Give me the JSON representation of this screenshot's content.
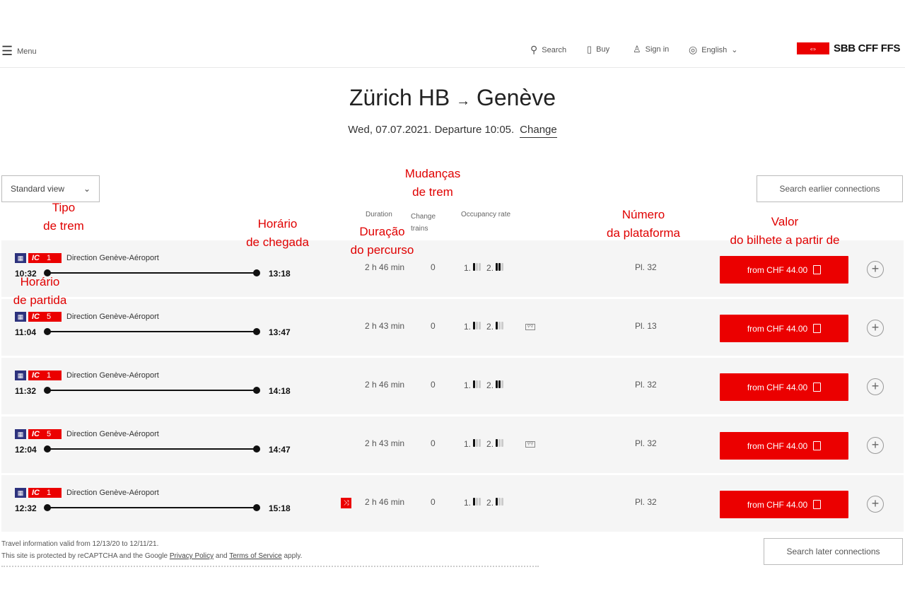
{
  "header": {
    "menu": "Menu",
    "search": "Search",
    "buy": "Buy",
    "sign_in": "Sign in",
    "language": "English",
    "logo": "SBB CFF FFS"
  },
  "journey": {
    "from": "Zürich HB",
    "arrow": "→",
    "to": "Genève",
    "date_line": "Wed, 07.07.2021. Departure 10:05.",
    "change": "Change"
  },
  "controls": {
    "view": "Standard view",
    "earlier": "Search earlier connections",
    "later": "Search later connections"
  },
  "columns": {
    "duration": "Duration",
    "change_trains": "Change trains",
    "occupancy": "Occupancy rate"
  },
  "annotations": {
    "tipo": "Tipo\nde trem",
    "chegada": "Horário\nde chegada",
    "mudancas": "Mudanças\nde trem",
    "duracao": "Duração\ndo percurso",
    "numero": "Número\nda plataforma",
    "valor": "Valor\ndo bilhete a partir de",
    "partida": "Horário\nde partida"
  },
  "colors": {
    "accent": "#eb0000",
    "row_bg": "#f5f5f5"
  },
  "connections": [
    {
      "train": "IC",
      "line": "1",
      "direction": "Direction Genève-Aéroport",
      "dep": "10:32",
      "arr": "13:18",
      "duration": "2 h 46 min",
      "changes": "0",
      "occ1_label": "1.",
      "occ1": 1,
      "occ2_label": "2.",
      "occ2": 2,
      "bike": false,
      "alert": false,
      "platform": "Pl. 32",
      "price": "from CHF 44.00"
    },
    {
      "train": "IC",
      "line": "5",
      "direction": "Direction Genève-Aéroport",
      "dep": "11:04",
      "arr": "13:47",
      "duration": "2 h 43 min",
      "changes": "0",
      "occ1_label": "1.",
      "occ1": 1,
      "occ2_label": "2.",
      "occ2": 1,
      "bike": true,
      "alert": false,
      "platform": "Pl. 13",
      "price": "from CHF 44.00"
    },
    {
      "train": "IC",
      "line": "1",
      "direction": "Direction Genève-Aéroport",
      "dep": "11:32",
      "arr": "14:18",
      "duration": "2 h 46 min",
      "changes": "0",
      "occ1_label": "1.",
      "occ1": 1,
      "occ2_label": "2.",
      "occ2": 2,
      "bike": false,
      "alert": false,
      "platform": "Pl. 32",
      "price": "from CHF 44.00"
    },
    {
      "train": "IC",
      "line": "5",
      "direction": "Direction Genève-Aéroport",
      "dep": "12:04",
      "arr": "14:47",
      "duration": "2 h 43 min",
      "changes": "0",
      "occ1_label": "1.",
      "occ1": 1,
      "occ2_label": "2.",
      "occ2": 1,
      "bike": true,
      "alert": false,
      "platform": "Pl. 32",
      "price": "from CHF 44.00"
    },
    {
      "train": "IC",
      "line": "1",
      "direction": "Direction Genève-Aéroport",
      "dep": "12:32",
      "arr": "15:18",
      "duration": "2 h 46 min",
      "changes": "0",
      "occ1_label": "1.",
      "occ1": 1,
      "occ2_label": "2.",
      "occ2": 1,
      "bike": false,
      "alert": true,
      "platform": "Pl. 32",
      "price": "from CHF 44.00"
    }
  ],
  "footer": {
    "valid": "Travel information valid from 12/13/20 to 12/11/21.",
    "recaptcha_pre": "This site is protected by reCAPTCHA and the Google ",
    "privacy": "Privacy Policy",
    "and": " and ",
    "terms": "Terms of Service",
    "apply": " apply."
  }
}
